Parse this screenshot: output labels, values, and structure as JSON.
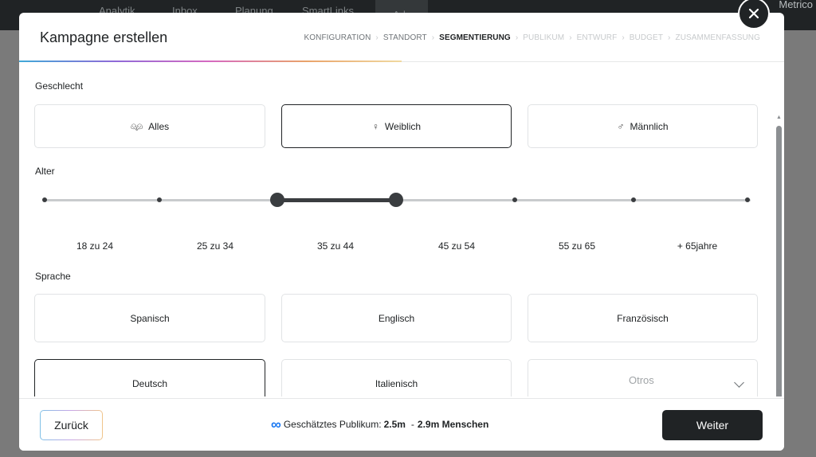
{
  "background_nav": {
    "items": [
      "Analytik",
      "Inbox",
      "Planung",
      "SmartLinks",
      "Ads"
    ],
    "brand": "Metrico"
  },
  "modal": {
    "title": "Kampagne erstellen",
    "close_icon": "close-icon",
    "steps": [
      {
        "label": "KONFIGURATION",
        "state": "done"
      },
      {
        "label": "STANDORT",
        "state": "done"
      },
      {
        "label": "SEGMENTIERUNG",
        "state": "current"
      },
      {
        "label": "PUBLIKUM",
        "state": "future"
      },
      {
        "label": "ENTWURF",
        "state": "future"
      },
      {
        "label": "BUDGET",
        "state": "future"
      },
      {
        "label": "ZUSAMMENFASSUNG",
        "state": "future"
      }
    ]
  },
  "gender": {
    "label": "Geschlecht",
    "options": [
      {
        "label": "Alles",
        "icon": "people-icon",
        "selected": false
      },
      {
        "label": "Weiblich",
        "icon": "female-icon",
        "selected": true
      },
      {
        "label": "Männlich",
        "icon": "male-icon",
        "selected": false
      }
    ]
  },
  "age": {
    "label": "Alter",
    "ranges": [
      "18 zu 24",
      "25 zu 34",
      "35 zu 44",
      "45 zu 54",
      "55 zu 65",
      "+ 65jahre"
    ],
    "selected_from": "35 zu 44",
    "selected_to": "45 zu 54"
  },
  "language": {
    "label": "Sprache",
    "options": [
      {
        "label": "Spanisch",
        "selected": false
      },
      {
        "label": "Englisch",
        "selected": false
      },
      {
        "label": "Französisch",
        "selected": false
      },
      {
        "label": "Deutsch",
        "selected": true
      },
      {
        "label": "Italienisch",
        "selected": false
      }
    ],
    "other_placeholder": "Otros"
  },
  "footer": {
    "back_label": "Zurück",
    "audience_prefix": "Geschätztes Publikum:",
    "audience_min": "2.5m",
    "audience_dash": "-",
    "audience_max": "2.9m Menschen",
    "next_label": "Weiter"
  },
  "colors": {
    "primary_dark": "#202325",
    "meta_blue": "#1877f2"
  }
}
